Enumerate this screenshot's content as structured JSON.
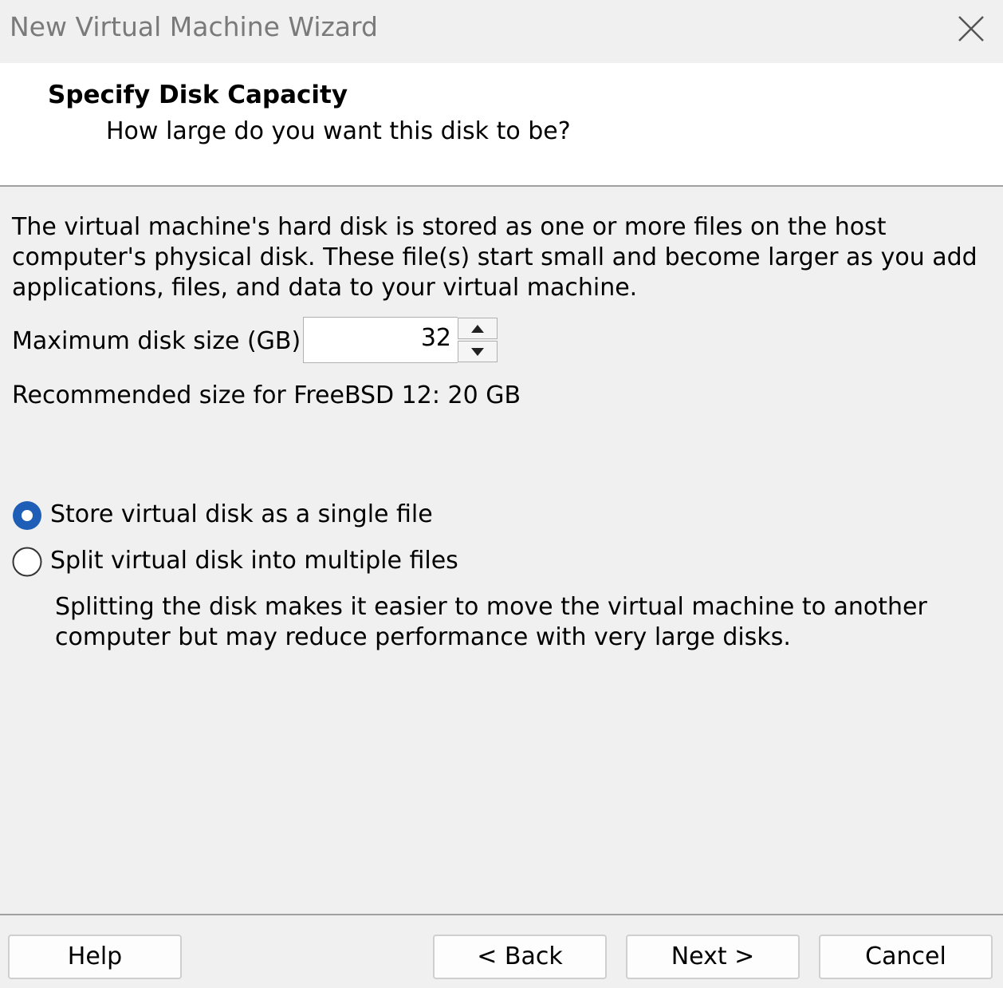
{
  "window": {
    "title": "New Virtual Machine Wizard"
  },
  "header": {
    "title": "Specify Disk Capacity",
    "subtitle": "How large do you want this disk to be?"
  },
  "main": {
    "description": "The virtual machine's hard disk is stored as one or more files on the host computer's physical disk. These file(s) start small and become larger as you add applications, files, and data to your virtual machine.",
    "disk_size": {
      "label": "Maximum disk size (GB):",
      "value": "32"
    },
    "recommended": "Recommended size for FreeBSD 12: 20 GB",
    "storage_options": [
      {
        "label": "Store virtual disk as a single file",
        "selected": true
      },
      {
        "label": "Split virtual disk into multiple files",
        "selected": false
      }
    ],
    "split_description": "Splitting the disk makes it easier to move the virtual machine to another computer but may reduce performance with very large disks."
  },
  "footer": {
    "help_label": "Help",
    "back_label": "< Back",
    "next_label": "Next >",
    "cancel_label": "Cancel"
  },
  "colors": {
    "radio_selected": "#1e5eb6",
    "title_text": "#7a7a7a"
  }
}
